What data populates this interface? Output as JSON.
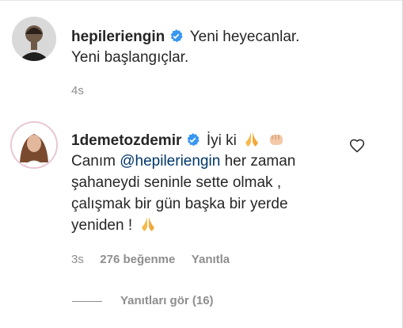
{
  "post": {
    "username": "hepileriengin",
    "caption_line1": "Yeni heyecanlar.",
    "caption_line2": "Yeni başlangıçlar.",
    "time": "4s"
  },
  "comment": {
    "username": "1demetozdemir",
    "text_start": "İyi ki",
    "mention_prefix": "Canım ",
    "mention": "@hepileriengin",
    "line2_tail": " her zaman",
    "line3": "şahaneydi seninle sette olmak ,",
    "line4": "çalışmak bir gün başka bir yerde",
    "line5": "yeniden !",
    "time": "3s",
    "likes": "276 beğenme",
    "reply_label": "Yanıtla",
    "view_replies": "Yanıtları gör (16)"
  },
  "colors": {
    "verified": "#3897f0",
    "mention": "#00376b",
    "meta": "#8e8e8e"
  },
  "icons": [
    "verified-badge-icon",
    "folded-hands-emoji",
    "fist-emoji",
    "heart-outline-icon"
  ]
}
